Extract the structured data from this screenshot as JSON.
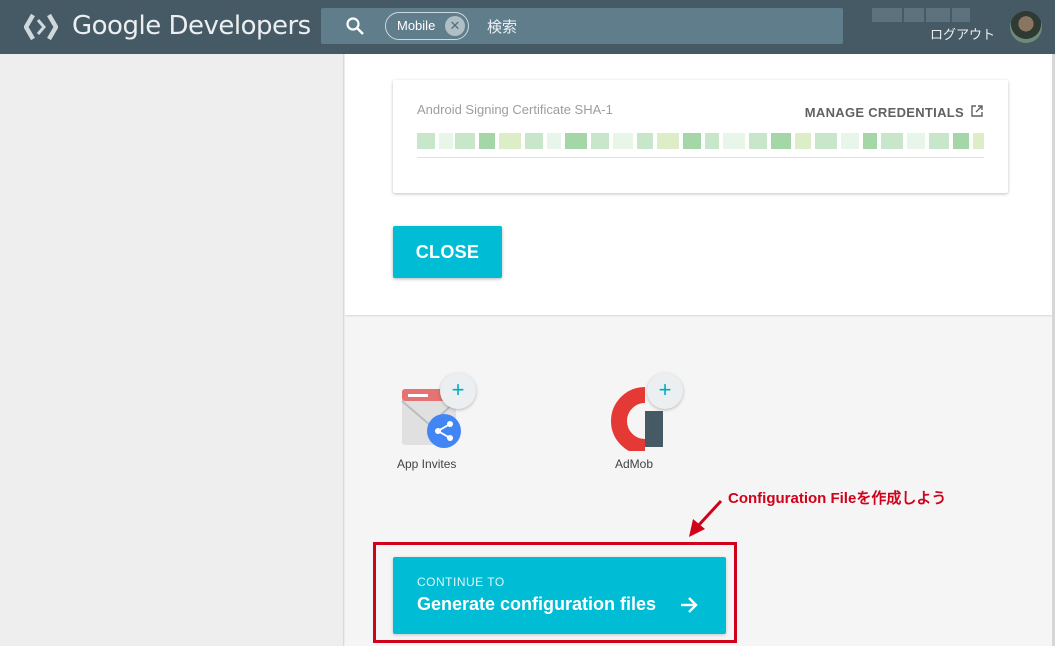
{
  "header": {
    "brand": "Google Developers",
    "search": {
      "chip_label": "Mobile",
      "placeholder": "検索"
    },
    "logout_label": "ログアウト"
  },
  "card": {
    "label": "Android Signing Certificate SHA-1",
    "manage_label": "MANAGE CREDENTIALS"
  },
  "close_button": "CLOSE",
  "apis": [
    {
      "label": "App Invites",
      "icon": "app-invites-icon"
    },
    {
      "label": "AdMob",
      "icon": "admob-icon"
    }
  ],
  "annotation": "Configuration Fileを作成しよう",
  "continue_button": {
    "small": "CONTINUE TO",
    "big": "Generate configuration files"
  },
  "colors": {
    "header_bg": "#455a64",
    "accent": "#00bcd4",
    "annotation_red": "#d0021b"
  }
}
